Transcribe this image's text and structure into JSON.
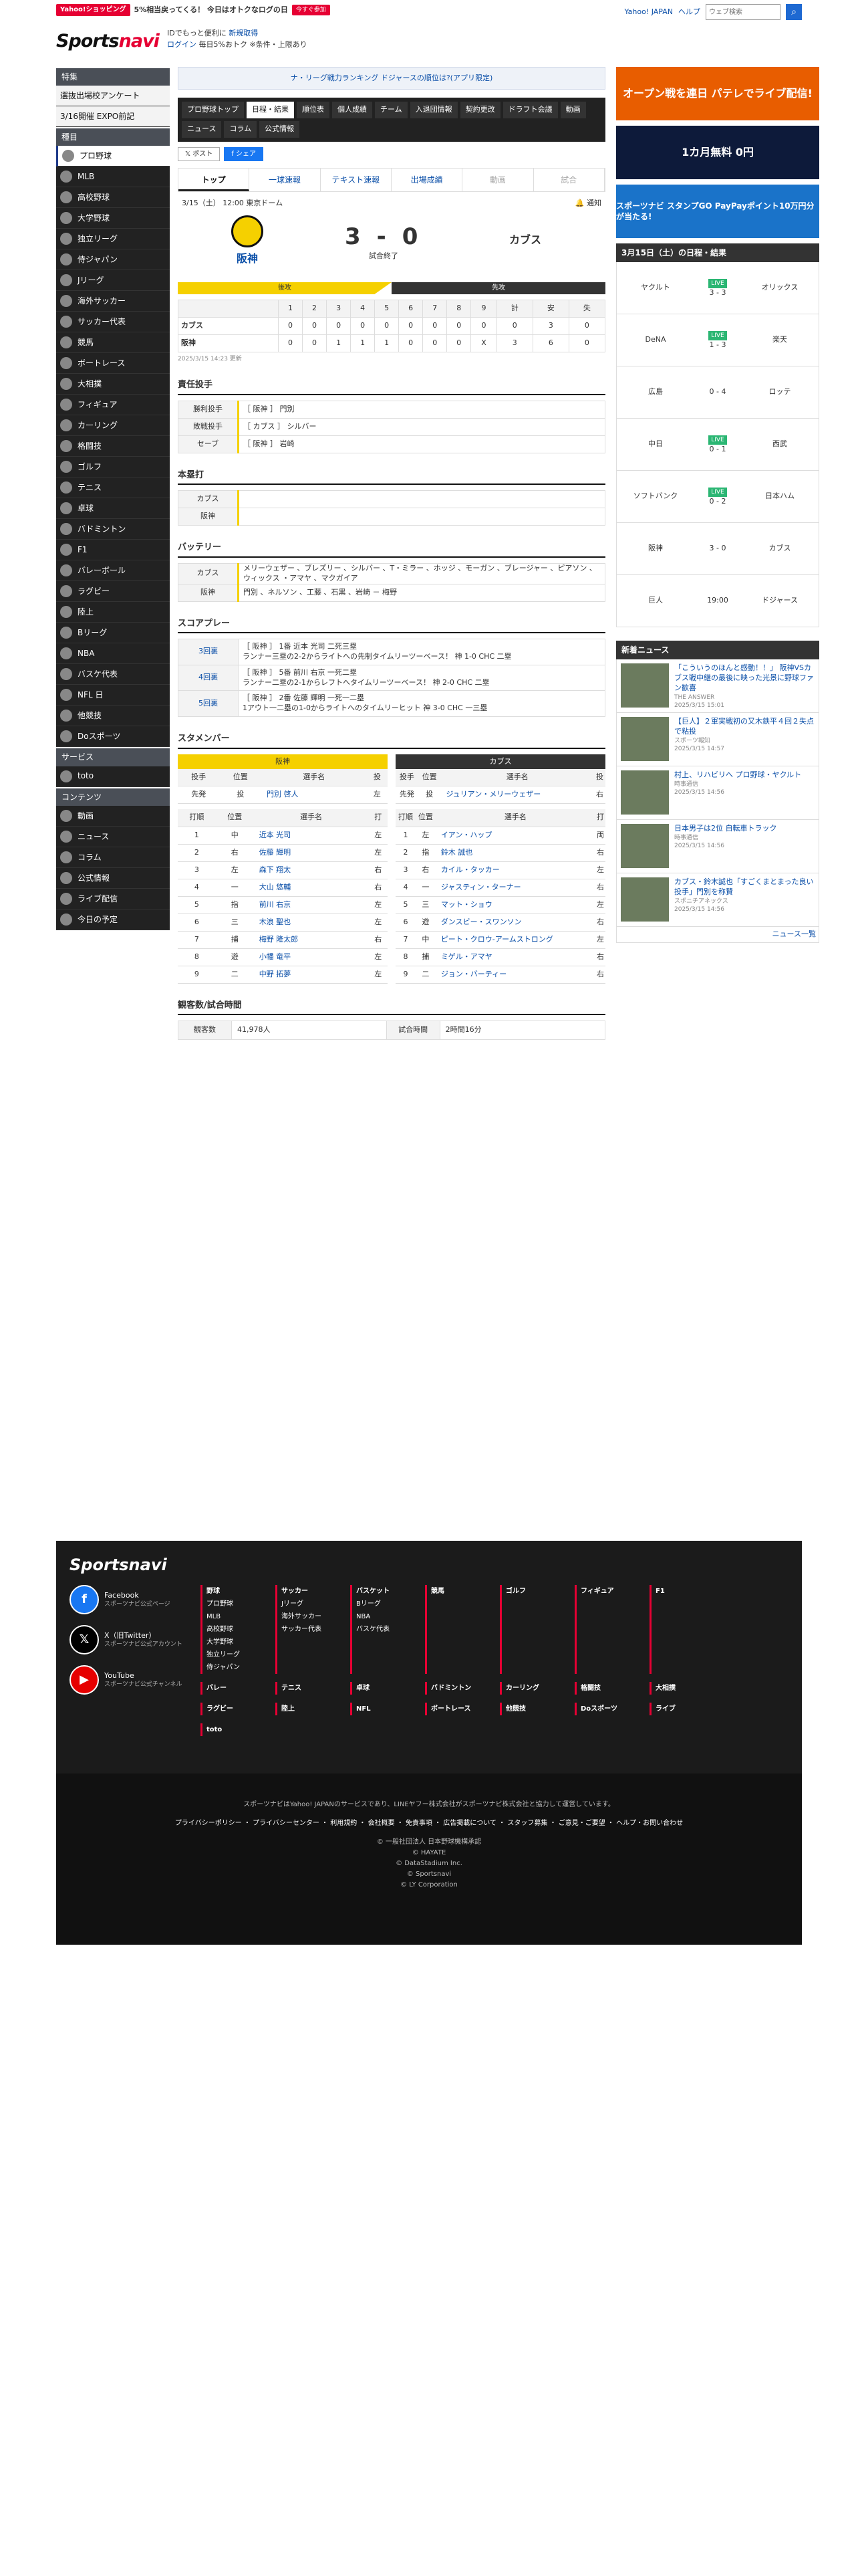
{
  "header": {
    "promo_tag": "Yahoo!ショッピング",
    "promo_text": "5%相当戻ってくる！ 今日はオトクなログの日",
    "promo_btn": "今すぐ参加",
    "logo_main": "Sports",
    "logo_sub": "navi",
    "login_line1": "IDでもっと便利に",
    "login_new": "新規取得",
    "login_line2_a": "ログイン",
    "login_line2_b": "毎日5%おトク ※条件・上限あり",
    "yahoo": "Yahoo! JAPAN",
    "help": "ヘルプ",
    "search_placeholder": "ウェブ検索",
    "search_btn_icon": "search-icon"
  },
  "sidebar": {
    "sections": [
      {
        "title": "特集",
        "items": [
          "選抜出場校アンケート",
          "3/16開催 EXPO前記"
        ]
      },
      {
        "title": "種目",
        "items": [
          "プロ野球",
          "MLB",
          "高校野球",
          "大学野球",
          "独立リーグ",
          "侍ジャパン",
          "Jリーグ",
          "海外サッカー",
          "サッカー代表",
          "競馬",
          "ボートレース",
          "大相撲",
          "フィギュア",
          "カーリング",
          "格闘技",
          "ゴルフ",
          "テニス",
          "卓球",
          "バドミントン",
          "F1",
          "バレーボール",
          "ラグビー",
          "陸上",
          "Bリーグ",
          "NBA",
          "バスケ代表",
          "NFL 日",
          "他競技",
          "Doスポーツ"
        ]
      },
      {
        "title": "サービス",
        "items": [
          "toto"
        ]
      },
      {
        "title": "コンテンツ",
        "items": [
          "動画",
          "ニュース",
          "コラム",
          "公式情報",
          "ライブ配信",
          "今日の予定"
        ]
      }
    ]
  },
  "main": {
    "notice": "ナ・リーグ戦力ランキング ドジャースの順位は?(アプリ限定)",
    "nav": [
      "プロ野球トップ",
      "日程・結果",
      "順位表",
      "個人成績",
      "チーム",
      "入退団情報",
      "契約更改",
      "ドラフト会議",
      "動画",
      "ニュース",
      "コラム",
      "公式情報"
    ],
    "share": [
      "𝕏 ポスト",
      "f シェア"
    ],
    "tabs": [
      "トップ",
      "一球速報",
      "テキスト速報",
      "出場成績",
      "動画",
      "試合"
    ],
    "date": "3/15（土） 12:00 東京ドーム",
    "notify": "通知",
    "home": "阪神",
    "away": "カブス",
    "home_score": "3",
    "away_score": "0",
    "state": "試合終了",
    "stripe_home": "後攻",
    "stripe_away": "先攻",
    "line_headers": [
      "",
      "1",
      "2",
      "3",
      "4",
      "5",
      "6",
      "7",
      "8",
      "9",
      "計",
      "安",
      "失"
    ],
    "line_rows": [
      [
        "カブス",
        "0",
        "0",
        "0",
        "0",
        "0",
        "0",
        "0",
        "0",
        "0",
        "0",
        "3",
        "0"
      ],
      [
        "阪神",
        "0",
        "0",
        "1",
        "1",
        "1",
        "0",
        "0",
        "0",
        "X",
        "3",
        "6",
        "0"
      ]
    ],
    "updated": "2025/3/15 14:23 更新",
    "resp_title": "責任投手",
    "resp": [
      [
        "勝利投手",
        "［ 阪神 ］ 門別"
      ],
      [
        "敗戦投手",
        "［ カブス ］ シルバー"
      ],
      [
        "セーブ",
        "［ 阪神 ］ 岩崎"
      ]
    ],
    "hr_title": "本塁打",
    "hr": [
      [
        "カブス",
        ""
      ],
      [
        "阪神",
        ""
      ]
    ],
    "bat_title": "バッテリー",
    "bat": [
      [
        "カブス",
        "メリーウェザー 、ブレズリー 、シルバー 、T・ミラー 、ホッジ 、モーガン 、ブレージャー 、ピアソン 、ウィックス ・アマヤ 、マクガイア"
      ],
      [
        "阪神",
        "門別 、ネルソン 、工藤 、石黒 、岩崎 － 梅野"
      ]
    ],
    "play_title": "スコアプレー",
    "play": [
      [
        "3回裏",
        "［ 阪神 ］ 1番 近本 光司 二死三塁\nランナー三塁の2-2からライトへの先制タイムリーツーベース！ 神 1-0 CHC 二塁"
      ],
      [
        "4回裏",
        "［ 阪神 ］ 5番 前川 右京 一死二塁\nランナー二塁の2-1からレフトへタイムリーツーベース！ 神 2-0 CHC 二塁"
      ],
      [
        "5回裏",
        "［ 阪神 ］ 2番 佐藤 輝明 一死一二塁\n1アウト一二塁の1-0からライトへのタイムリーヒット 神 3-0 CHC 一三塁"
      ]
    ],
    "start_title": "スタメンバー",
    "home_pitch_h": [
      "投手",
      "位置",
      "選手名",
      "投"
    ],
    "home_pitch": [
      "先発",
      "投",
      "門別 啓人",
      "左"
    ],
    "away_pitch": [
      "先発",
      "投",
      "ジュリアン・メリーウェザー",
      "右"
    ],
    "bat_h": [
      "打順",
      "位置",
      "選手名",
      "打"
    ],
    "home_lineup": [
      [
        "1",
        "中",
        "近本 光司",
        "左"
      ],
      [
        "2",
        "右",
        "佐藤 輝明",
        "左"
      ],
      [
        "3",
        "左",
        "森下 翔太",
        "右"
      ],
      [
        "4",
        "一",
        "大山 悠輔",
        "右"
      ],
      [
        "5",
        "指",
        "前川 右京",
        "左"
      ],
      [
        "6",
        "三",
        "木浪 聖也",
        "左"
      ],
      [
        "7",
        "捕",
        "梅野 隆太郎",
        "右"
      ],
      [
        "8",
        "遊",
        "小幡 竜平",
        "左"
      ],
      [
        "9",
        "二",
        "中野 拓夢",
        "左"
      ]
    ],
    "away_lineup": [
      [
        "1",
        "左",
        "イアン・ハップ",
        "両"
      ],
      [
        "2",
        "指",
        "鈴木 誠也",
        "右"
      ],
      [
        "3",
        "右",
        "カイル・タッカー",
        "左"
      ],
      [
        "4",
        "一",
        "ジャスティン・ターナー",
        "右"
      ],
      [
        "5",
        "三",
        "マット・ショウ",
        "左"
      ],
      [
        "6",
        "遊",
        "ダンスビー・スワンソン",
        "右"
      ],
      [
        "7",
        "中",
        "ピート・クロウ-アームストロング",
        "左"
      ],
      [
        "8",
        "捕",
        "ミゲル・アマヤ",
        "右"
      ],
      [
        "9",
        "二",
        "ジョン・バーティー",
        "右"
      ]
    ],
    "att_title": "観客数/試合時間",
    "att_k1": "観客数",
    "att_v1": "41,978人",
    "att_k2": "試合時間",
    "att_v2": "2時間16分"
  },
  "right": {
    "ads": [
      "オープン戦を連日 パテレでライブ配信!",
      "1カ月無料 0円",
      "スポーツナビ スタンプGO PayPayポイント10万円分が当たる!"
    ],
    "games_title": "3月15日（土）の日程・結果",
    "games": [
      [
        "ヤクルト",
        "3 - 3",
        "オリックス",
        "LIVE"
      ],
      [
        "DeNA",
        "1 - 3",
        "楽天",
        "LIVE"
      ],
      [
        "広島",
        "0 - 4",
        "ロッテ",
        ""
      ],
      [
        "中日",
        "0 - 1",
        "西武",
        "LIVE"
      ],
      [
        "ソフトバンク",
        "0 - 2",
        "日本ハム",
        "LIVE"
      ],
      [
        "阪神",
        "3 - 0",
        "カブス",
        ""
      ],
      [
        "巨人",
        "19:00",
        "ドジャース",
        ""
      ]
    ],
    "news_title": "新着ニュース",
    "news": [
      [
        "「こういうのほんと感動！！」 阪神VSカブス戦中継の最後に映った光景に野球ファン歓喜",
        "THE ANSWER",
        "2025/3/15 15:01"
      ],
      [
        "【巨人】２軍実戦初の又木鉄平４回２失点で粘投",
        "スポーツ報知",
        "2025/3/15 14:57"
      ],
      [
        "村上、リハビリへ プロ野球・ヤクルト",
        "時事通信",
        "2025/3/15 14:56"
      ],
      [
        "日本男子は2位 自転車トラック",
        "時事通信",
        "2025/3/15 14:56"
      ],
      [
        "カブス・鈴木誠也「すごくまとまった良い投手」門別を称賛",
        "スポニチアネックス",
        "2025/3/15 14:56"
      ]
    ],
    "news_more": "ニュース一覧"
  },
  "footer": {
    "logo": "Sportsnavi",
    "social": [
      [
        "Facebook",
        "スポーツナビ公式ページ"
      ],
      [
        "X（旧Twitter）",
        "スポーツナビ公式アカウント"
      ],
      [
        "YouTube",
        "スポーツナビ公式チャンネル"
      ]
    ],
    "cols": [
      [
        "野球",
        "プロ野球",
        "MLB",
        "高校野球",
        "大学野球",
        "独立リーグ",
        "侍ジャパン"
      ],
      [
        "サッカー",
        "Jリーグ",
        "海外サッカー",
        "サッカー代表"
      ],
      [
        "バスケット",
        "Bリーグ",
        "NBA",
        "バスケ代表"
      ],
      [
        "競馬"
      ],
      [
        "ゴルフ"
      ],
      [
        "フィギュア"
      ],
      [
        "F1"
      ],
      [
        "バレー"
      ],
      [
        "テニス"
      ],
      [
        "卓球"
      ],
      [
        "バドミントン"
      ],
      [
        "カーリング"
      ],
      [
        "格闘技"
      ],
      [
        "大相撲"
      ],
      [
        "ラグビー"
      ],
      [
        "陸上"
      ],
      [
        "NFL"
      ],
      [
        "ボートレース"
      ],
      [
        "他競技"
      ],
      [
        "Doスポーツ"
      ],
      [
        "ライブ"
      ],
      [
        "toto"
      ]
    ],
    "legal1": "スポーツナビはYahoo! JAPANのサービスであり、LINEヤフー株式会社がスポーツナビ株式会社と協力して運営しています。",
    "legal2": "プライバシーポリシー ・ プライバシーセンター ・ 利用規約 ・ 会社概要 ・ 免責事項 ・ 広告掲載について ・ スタッフ募集 ・ ご意見・ご要望 ・ ヘルプ・お問い合わせ",
    "copy": "© 一般社団法人 日本野球機構承認\n© HAYATE\n© DataStadium Inc.\n© Sportsnavi\n© LY Corporation"
  }
}
